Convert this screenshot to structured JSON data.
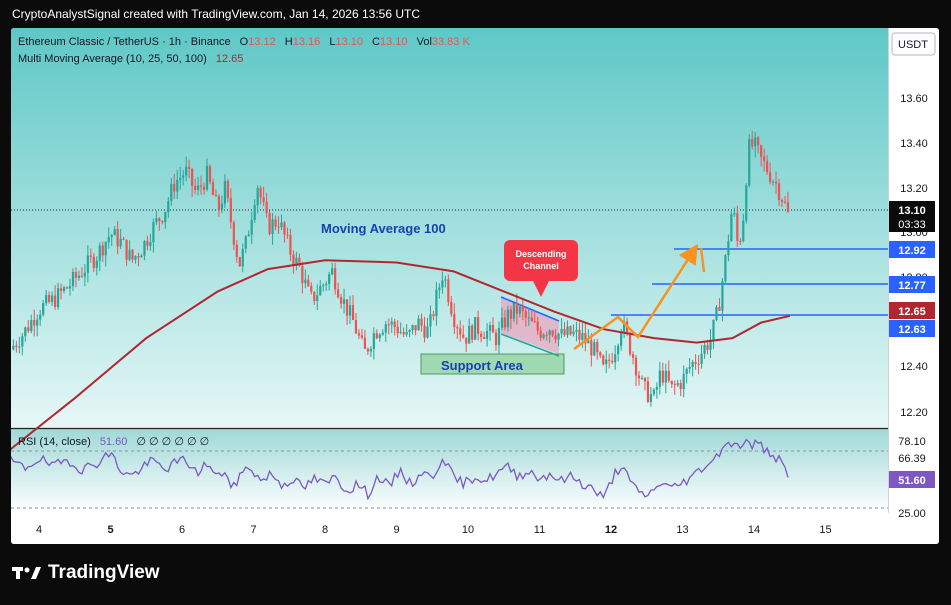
{
  "watermark": "CryptoAnalystSignal created with TradingView.com, Jan 14, 2026 13:56 UTC",
  "footer": {
    "brand": "TradingView"
  },
  "currency_button": "USDT",
  "legend": {
    "symbol": "Ethereum Classic / TetherUS · 1h · Binance",
    "o_label": "O",
    "o": "13.12",
    "h_label": "H",
    "h": "13.16",
    "l_label": "L",
    "l": "13.10",
    "c_label": "C",
    "c": "13.10",
    "vol_label": "Vol",
    "vol": "33.83 K",
    "ma_label": "Multi Moving Average (10, 25, 50, 100)",
    "ma_value": "12.65"
  },
  "rsi_legend": {
    "label": "RSI (14, close)",
    "value": "51.60",
    "extras": "∅ ∅ ∅ ∅ ∅ ∅"
  },
  "annotations": {
    "ma100": "Moving Average 100",
    "channel_line1": "Descending",
    "channel_line2": "Channel",
    "support": "Support Area"
  },
  "price_badges": {
    "last": "13.10",
    "countdown": "03:33",
    "l1292": "12.92",
    "l1277": "12.77",
    "l1265": "12.65",
    "l1263": "12.63"
  },
  "colors": {
    "up": "#26a69a",
    "down": "#ef5350",
    "ma": "#b2262f",
    "rsi": "#7e57c2",
    "hline": "#2962ff",
    "arrow": "#f7931e",
    "support_fill": "#81c784",
    "bg_top": "#5ec8c6"
  },
  "chart_data": [
    {
      "type": "candlestick",
      "title": "Ethereum Classic / TetherUS · 1h · Binance",
      "x_tick_labels": [
        "4",
        "5",
        "6",
        "7",
        "8",
        "9",
        "10",
        "11",
        "12",
        "13",
        "14",
        "15"
      ],
      "y_tick_labels": [
        "12.20",
        "12.40",
        "12.80",
        "13.00",
        "13.20",
        "13.40",
        "13.60"
      ],
      "ylim": [
        12.13,
        13.75
      ],
      "close_path": [
        [
          3.6,
          12.5
        ],
        [
          3.8,
          12.58
        ],
        [
          4.0,
          12.68
        ],
        [
          4.2,
          12.72
        ],
        [
          4.4,
          12.78
        ],
        [
          4.6,
          12.85
        ],
        [
          4.8,
          12.92
        ],
        [
          5.0,
          13.02
        ],
        [
          5.15,
          12.98
        ],
        [
          5.3,
          12.9
        ],
        [
          5.45,
          12.96
        ],
        [
          5.6,
          13.05
        ],
        [
          5.75,
          13.12
        ],
        [
          5.9,
          13.25
        ],
        [
          6.05,
          13.3
        ],
        [
          6.2,
          13.2
        ],
        [
          6.35,
          13.28
        ],
        [
          6.5,
          13.12
        ],
        [
          6.6,
          13.22
        ],
        [
          6.7,
          13.05
        ],
        [
          6.8,
          12.88
        ],
        [
          6.9,
          12.98
        ],
        [
          7.05,
          13.25
        ],
        [
          7.2,
          13.05
        ],
        [
          7.35,
          13.08
        ],
        [
          7.5,
          12.95
        ],
        [
          7.65,
          12.86
        ],
        [
          7.8,
          12.72
        ],
        [
          7.95,
          12.78
        ],
        [
          8.1,
          12.85
        ],
        [
          8.25,
          12.72
        ],
        [
          8.4,
          12.62
        ],
        [
          8.55,
          12.48
        ],
        [
          8.7,
          12.58
        ],
        [
          8.85,
          12.62
        ],
        [
          9.0,
          12.6
        ],
        [
          9.15,
          12.55
        ],
        [
          9.3,
          12.62
        ],
        [
          9.45,
          12.58
        ],
        [
          9.55,
          12.72
        ],
        [
          9.65,
          12.85
        ],
        [
          9.8,
          12.65
        ],
        [
          9.95,
          12.55
        ],
        [
          10.1,
          12.6
        ],
        [
          10.25,
          12.58
        ],
        [
          10.4,
          12.55
        ],
        [
          10.55,
          12.65
        ],
        [
          10.7,
          12.68
        ],
        [
          10.85,
          12.62
        ],
        [
          11.0,
          12.58
        ],
        [
          11.15,
          12.6
        ],
        [
          11.3,
          12.56
        ],
        [
          11.45,
          12.57
        ],
        [
          11.6,
          12.55
        ],
        [
          11.75,
          12.5
        ],
        [
          11.9,
          12.4
        ],
        [
          12.05,
          12.5
        ],
        [
          12.15,
          12.62
        ],
        [
          12.3,
          12.48
        ],
        [
          12.45,
          12.32
        ],
        [
          12.6,
          12.28
        ],
        [
          12.7,
          12.4
        ],
        [
          12.85,
          12.32
        ],
        [
          13.0,
          12.36
        ],
        [
          13.1,
          12.42
        ],
        [
          13.25,
          12.48
        ],
        [
          13.4,
          12.55
        ],
        [
          13.5,
          12.68
        ],
        [
          13.6,
          12.9
        ],
        [
          13.7,
          13.15
        ],
        [
          13.78,
          12.95
        ],
        [
          13.85,
          13.1
        ],
        [
          13.92,
          13.4
        ],
        [
          14.0,
          13.42
        ],
        [
          14.1,
          13.35
        ],
        [
          14.2,
          13.3
        ],
        [
          14.3,
          13.25
        ],
        [
          14.4,
          13.18
        ],
        [
          14.48,
          13.1
        ]
      ],
      "moving_average_100": [
        [
          3.6,
          12.05
        ],
        [
          4.5,
          12.28
        ],
        [
          5.5,
          12.55
        ],
        [
          6.5,
          12.76
        ],
        [
          7.2,
          12.86
        ],
        [
          8.0,
          12.9
        ],
        [
          9.0,
          12.89
        ],
        [
          9.8,
          12.85
        ],
        [
          10.5,
          12.76
        ],
        [
          11.2,
          12.67
        ],
        [
          11.9,
          12.59
        ],
        [
          12.6,
          12.55
        ],
        [
          13.2,
          12.53
        ],
        [
          13.7,
          12.55
        ],
        [
          14.1,
          12.62
        ],
        [
          14.5,
          12.65
        ]
      ],
      "horizontal_lines": [
        12.92,
        12.77,
        12.63
      ],
      "support_area": [
        12.48,
        12.56
      ]
    },
    {
      "type": "line",
      "title": "RSI (14, close)",
      "y_tick_labels": [
        "78.10",
        "66.39",
        "51.60",
        "25.00"
      ],
      "ylim": [
        20,
        85
      ],
      "points": [
        [
          3.6,
          62
        ],
        [
          3.8,
          56
        ],
        [
          4.0,
          64
        ],
        [
          4.2,
          57
        ],
        [
          4.4,
          63
        ],
        [
          4.6,
          55
        ],
        [
          4.8,
          60
        ],
        [
          5.0,
          68
        ],
        [
          5.15,
          54
        ],
        [
          5.3,
          50
        ],
        [
          5.45,
          57
        ],
        [
          5.6,
          62
        ],
        [
          5.75,
          55
        ],
        [
          5.9,
          60
        ],
        [
          6.05,
          63
        ],
        [
          6.2,
          52
        ],
        [
          6.35,
          60
        ],
        [
          6.5,
          48
        ],
        [
          6.6,
          55
        ],
        [
          6.7,
          38
        ],
        [
          6.8,
          50
        ],
        [
          6.95,
          58
        ],
        [
          7.1,
          46
        ],
        [
          7.25,
          52
        ],
        [
          7.4,
          43
        ],
        [
          7.55,
          48
        ],
        [
          7.7,
          40
        ],
        [
          7.85,
          48
        ],
        [
          8.0,
          43
        ],
        [
          8.15,
          50
        ],
        [
          8.3,
          38
        ],
        [
          8.45,
          44
        ],
        [
          8.6,
          36
        ],
        [
          8.75,
          50
        ],
        [
          8.9,
          41
        ],
        [
          9.05,
          55
        ],
        [
          9.2,
          43
        ],
        [
          9.35,
          53
        ],
        [
          9.5,
          48
        ],
        [
          9.65,
          66
        ],
        [
          9.8,
          48
        ],
        [
          9.95,
          44
        ],
        [
          10.1,
          50
        ],
        [
          10.25,
          46
        ],
        [
          10.4,
          52
        ],
        [
          10.55,
          57
        ],
        [
          10.7,
          50
        ],
        [
          10.85,
          54
        ],
        [
          11.0,
          48
        ],
        [
          11.15,
          52
        ],
        [
          11.3,
          46
        ],
        [
          11.45,
          50
        ],
        [
          11.6,
          44
        ],
        [
          11.75,
          40
        ],
        [
          11.9,
          32
        ],
        [
          12.05,
          52
        ],
        [
          12.15,
          58
        ],
        [
          12.3,
          42
        ],
        [
          12.45,
          35
        ],
        [
          12.6,
          38
        ],
        [
          12.7,
          46
        ],
        [
          12.85,
          40
        ],
        [
          13.0,
          45
        ],
        [
          13.15,
          50
        ],
        [
          13.3,
          58
        ],
        [
          13.45,
          63
        ],
        [
          13.55,
          72
        ],
        [
          13.65,
          78
        ],
        [
          13.75,
          72
        ],
        [
          13.85,
          77
        ],
        [
          13.95,
          74
        ],
        [
          14.05,
          76
        ],
        [
          14.15,
          70
        ],
        [
          14.25,
          68
        ],
        [
          14.35,
          62
        ],
        [
          14.48,
          52
        ]
      ]
    }
  ]
}
